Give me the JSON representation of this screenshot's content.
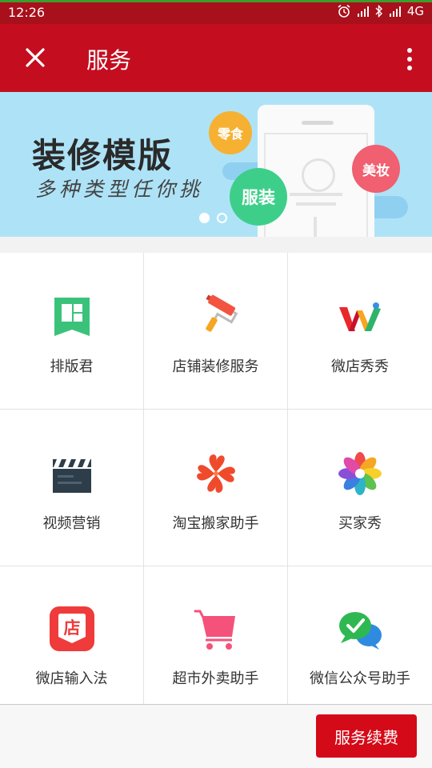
{
  "status_bar": {
    "time": "12:26",
    "network": "4G"
  },
  "app_bar": {
    "title": "服务"
  },
  "banner": {
    "headline": "装修模版",
    "subline": "多种类型任你挑",
    "bubbles": [
      "零食",
      "服装",
      "美妆"
    ],
    "page_count": 2,
    "active_page": 1
  },
  "services": [
    {
      "label": "排版君",
      "icon": "layout-icon"
    },
    {
      "label": "店铺装修服务",
      "icon": "paint-roller-icon"
    },
    {
      "label": "微店秀秀",
      "icon": "w-logo-icon"
    },
    {
      "label": "视频营销",
      "icon": "clapperboard-icon"
    },
    {
      "label": "淘宝搬家助手",
      "icon": "clover-icon"
    },
    {
      "label": "买家秀",
      "icon": "pinwheel-icon"
    },
    {
      "label": "微店输入法",
      "icon": "store-keyboard-icon"
    },
    {
      "label": "超市外卖助手",
      "icon": "shopping-cart-icon"
    },
    {
      "label": "微信公众号助手",
      "icon": "wechat-check-icon"
    }
  ],
  "bottom_bar": {
    "renew_label": "服务续费"
  },
  "colors": {
    "status_bar": "#a8101c",
    "app_bar": "#c40e20",
    "banner_bg": "#aee3f7",
    "renew_button": "#d40a18"
  }
}
